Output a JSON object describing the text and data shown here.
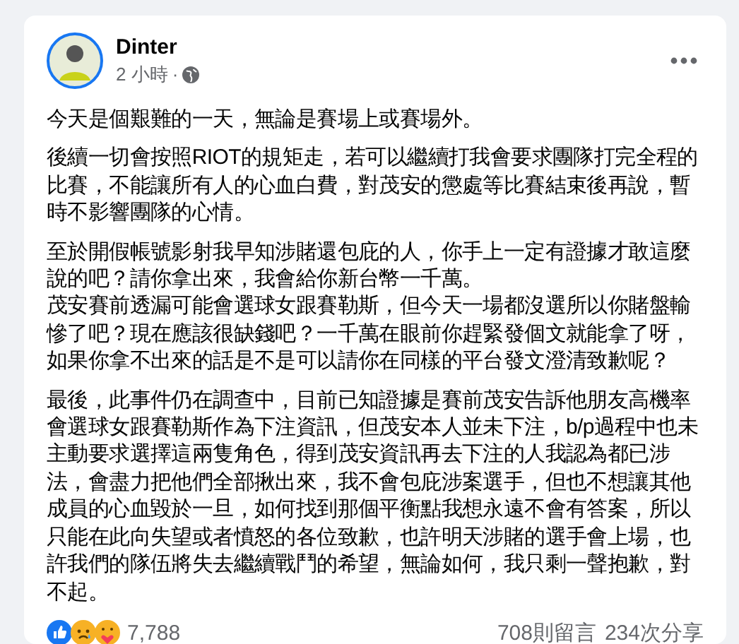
{
  "post": {
    "author": "Dinter",
    "time": "2 小時",
    "separator": "·",
    "paragraphs": [
      {
        "lines": [
          "今天是個艱難的一天，無論是賽場上或賽場外。"
        ]
      },
      {
        "lines": [
          "後續一切會按照RIOT的規矩走，若可以繼續打我會要求團隊打完全程的比賽，不能讓所有人的心血白費，對茂安的懲處等比賽結束後再說，暫時不影響團隊的心情。"
        ]
      },
      {
        "lines": [
          "至於開假帳號影射我早知涉賭還包庇的人，你手上一定有證據才敢這麼說的吧？請你拿出來，我會給你新台幣一千萬。",
          "茂安賽前透漏可能會選球女跟賽勒斯，但今天一場都沒選所以你賭盤輸慘了吧？現在應該很缺錢吧？一千萬在眼前你趕緊發個文就能拿了呀，如果你拿不出來的話是不是可以請你在同樣的平台發文澄清致歉呢？"
        ]
      },
      {
        "lines": [
          "最後，此事件仍在調查中，目前已知證據是賽前茂安告訴他朋友高機率會選球女跟賽勒斯作為下注資訊，但茂安本人並未下注，b/p過程中也未主動要求選擇這兩隻角色，得到茂安資訊再去下注的人我認為都已涉法，會盡力把他們全部揪出來，我不會包庇涉案選手，但也不想讓其他成員的心血毀於一旦，如何找到那個平衡點我想永遠不會有答案，所以只能在此向失望或者憤怒的各位致歉，也許明天涉賭的選手會上場，也許我們的隊伍將失去繼續戰鬥的希望，無論如何，我只剩一聲抱歉，對不起。"
        ]
      }
    ],
    "reactions": [
      {
        "kind": "like"
      },
      {
        "kind": "sad"
      },
      {
        "kind": "care"
      }
    ],
    "reaction_count": "7,788",
    "comments": "708則留言",
    "shares": "234次分享"
  }
}
